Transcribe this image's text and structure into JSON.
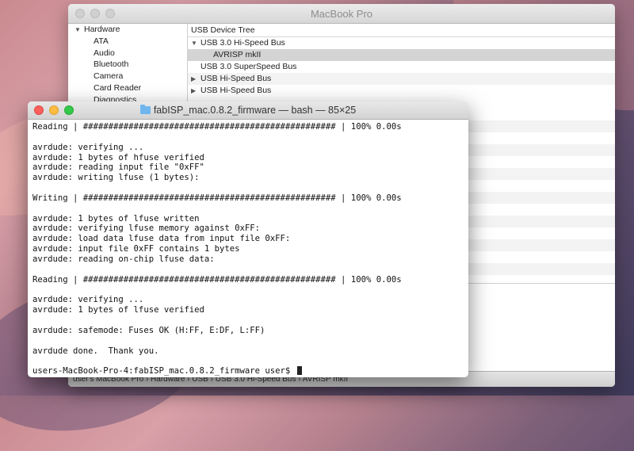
{
  "system_info": {
    "title": "MacBook Pro",
    "sidebar": {
      "group_label": "Hardware",
      "items": [
        "ATA",
        "Audio",
        "Bluetooth",
        "Camera",
        "Card Reader",
        "Diagnostics"
      ]
    },
    "main": {
      "header": "USB Device Tree",
      "rows": [
        {
          "label": "USB 3.0 Hi-Speed Bus",
          "expanded": true
        },
        {
          "label": "AVRISP mkII",
          "selected": true
        },
        {
          "label": "USB 3.0 SuperSpeed Bus"
        },
        {
          "label": "USB Hi-Speed Bus",
          "expanded": false
        },
        {
          "label": "USB Hi-Speed Bus",
          "expanded": false
        }
      ]
    },
    "path_bar": "user's MacBook Pro › Hardware › USB › USB 3.0 Hi-Speed Bus › AVRISP mkII"
  },
  "terminal": {
    "title": "fabISP_mac.0.8.2_firmware — bash — 85×25",
    "lines": [
      "Reading | ################################################## | 100% 0.00s",
      "",
      "avrdude: verifying ...",
      "avrdude: 1 bytes of hfuse verified",
      "avrdude: reading input file \"0xFF\"",
      "avrdude: writing lfuse (1 bytes):",
      "",
      "Writing | ################################################## | 100% 0.00s",
      "",
      "avrdude: 1 bytes of lfuse written",
      "avrdude: verifying lfuse memory against 0xFF:",
      "avrdude: load data lfuse data from input file 0xFF:",
      "avrdude: input file 0xFF contains 1 bytes",
      "avrdude: reading on-chip lfuse data:",
      "",
      "Reading | ################################################## | 100% 0.00s",
      "",
      "avrdude: verifying ...",
      "avrdude: 1 bytes of lfuse verified",
      "",
      "avrdude: safemode: Fuses OK (H:FF, E:DF, L:FF)",
      "",
      "avrdude done.  Thank you.",
      "",
      "users-MacBook-Pro-4:fabISP_mac.0.8.2_firmware user$ "
    ]
  }
}
